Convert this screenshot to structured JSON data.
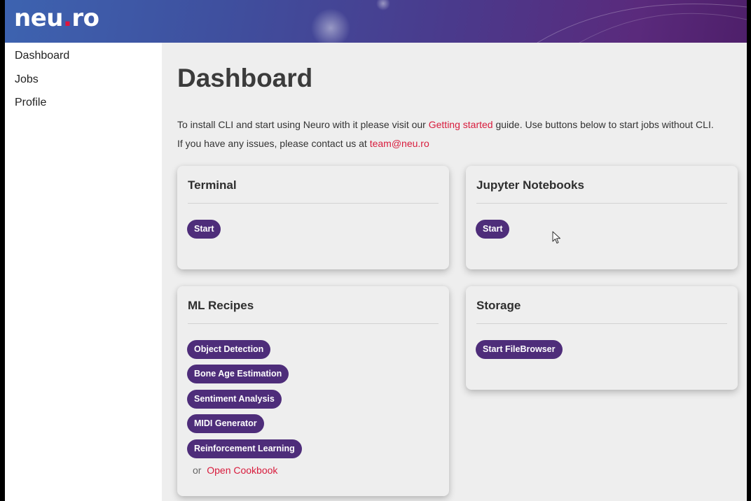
{
  "header": {
    "logo_prefix": "neu",
    "logo_dot": ".",
    "logo_suffix": "ro"
  },
  "sidebar": {
    "items": [
      {
        "label": "Dashboard"
      },
      {
        "label": "Jobs"
      },
      {
        "label": "Profile"
      }
    ]
  },
  "main": {
    "title": "Dashboard",
    "intro1": {
      "before": "To install CLI and start using Neuro with it please visit our ",
      "link": "Getting started",
      "after": " guide. Use buttons below to start jobs without CLI."
    },
    "intro2": {
      "before": "If you have any issues, please contact us at ",
      "link": "team@neu.ro"
    }
  },
  "cards": {
    "terminal": {
      "title": "Terminal",
      "button": "Start"
    },
    "jupyter": {
      "title": "Jupyter Notebooks",
      "button": "Start"
    },
    "recipes": {
      "title": "ML Recipes",
      "items": [
        "Object Detection",
        "Bone Age Estimation",
        "Sentiment Analysis",
        "MIDI Generator",
        "Reinforcement Learning"
      ],
      "or": "or",
      "cookbook": "Open Cookbook"
    },
    "storage": {
      "title": "Storage",
      "button": "Start FileBrowser"
    }
  },
  "colors": {
    "accent": "#4e2d7a",
    "link": "#d81b3c",
    "logo_dot": "#e0143c"
  },
  "icons": {
    "cursor": "mouse-pointer-icon"
  }
}
